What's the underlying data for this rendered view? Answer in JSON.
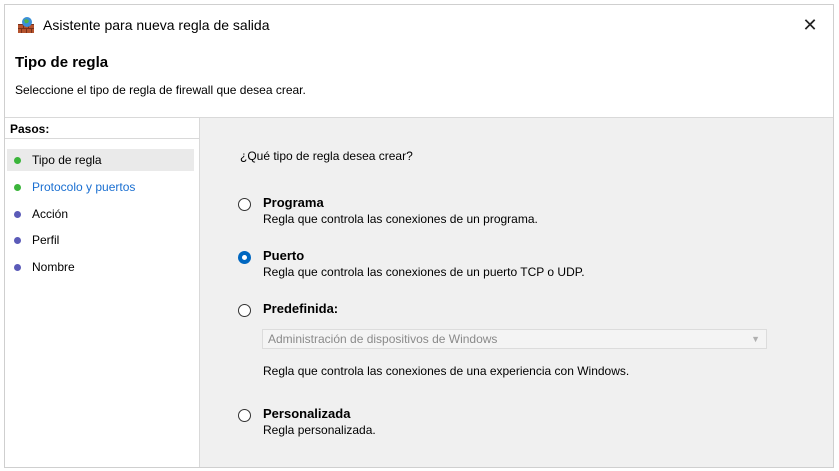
{
  "window": {
    "title": "Asistente para nueva regla de salida",
    "close_glyph": "✕"
  },
  "header": {
    "title": "Tipo de regla",
    "description": "Seleccione el tipo de regla de firewall que desea crear."
  },
  "sidebar": {
    "title": "Pasos:",
    "steps": [
      {
        "label": "Tipo de regla",
        "status_color": "#3bb53b",
        "selected": true
      },
      {
        "label": "Protocolo y puertos",
        "status_color": "#3bb53b",
        "link": true
      },
      {
        "label": "Acción",
        "status_color": "#5b5bb8"
      },
      {
        "label": "Perfil",
        "status_color": "#5b5bb8"
      },
      {
        "label": "Nombre",
        "status_color": "#5b5bb8"
      }
    ]
  },
  "main": {
    "question": "¿Qué tipo de regla desea crear?",
    "options": [
      {
        "title": "Programa",
        "description": "Regla que controla las conexiones de un programa.",
        "checked": false
      },
      {
        "title": "Puerto",
        "description": "Regla que controla las conexiones de un puerto TCP o UDP.",
        "checked": true
      },
      {
        "title": "Predefinida:",
        "checked": false
      },
      {
        "title": "Personalizada",
        "description": "Regla personalizada.",
        "checked": false
      }
    ],
    "predefined_dropdown": {
      "value": "Administración de dispositivos de Windows",
      "description": "Regla que controla las conexiones de una experiencia con Windows."
    }
  },
  "colors": {
    "accent": "#0067c0",
    "link": "#1a6fd1",
    "panel_bg": "#f0f0f0"
  }
}
